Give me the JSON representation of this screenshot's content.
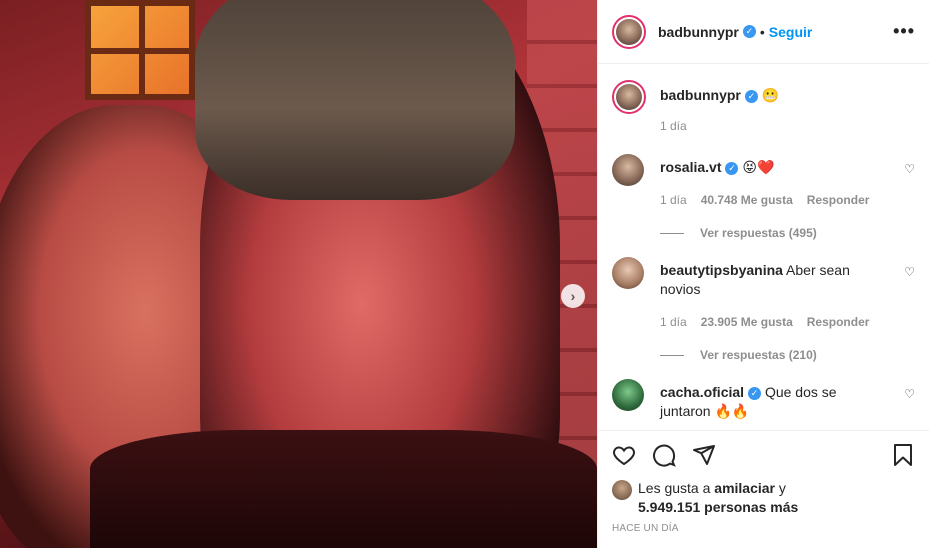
{
  "header": {
    "username": "badbunnypr",
    "follow_label": "Seguir",
    "dot": "•",
    "more": "•••"
  },
  "caption": {
    "username": "badbunnypr",
    "text": "😬",
    "time": "1 día"
  },
  "comments": [
    {
      "username": "rosalia.vt",
      "verified": true,
      "text": "😝❤️",
      "time": "1 día",
      "likes": "40.748 Me gusta",
      "reply_label": "Responder",
      "view_replies": "Ver respuestas (495)"
    },
    {
      "username": "beautytipsbyanina",
      "verified": false,
      "text": "Aber sean novios",
      "time": "1 día",
      "likes": "23.905 Me gusta",
      "reply_label": "Responder",
      "view_replies": "Ver respuestas (210)"
    },
    {
      "username": "cacha.oficial",
      "verified": true,
      "text": "Que dos se juntaron 🔥🔥",
      "time": "",
      "likes": "",
      "reply_label": "",
      "view_replies": ""
    }
  ],
  "likes": {
    "prefix": "Les gusta a ",
    "user": "amilaciar",
    "middle": " y ",
    "others": "5.949.151 personas más"
  },
  "timestamp": "HACE UN DÍA",
  "colors": {
    "follow": "#0095f6",
    "verified": "#3897f0",
    "heart": "#ed4956"
  }
}
